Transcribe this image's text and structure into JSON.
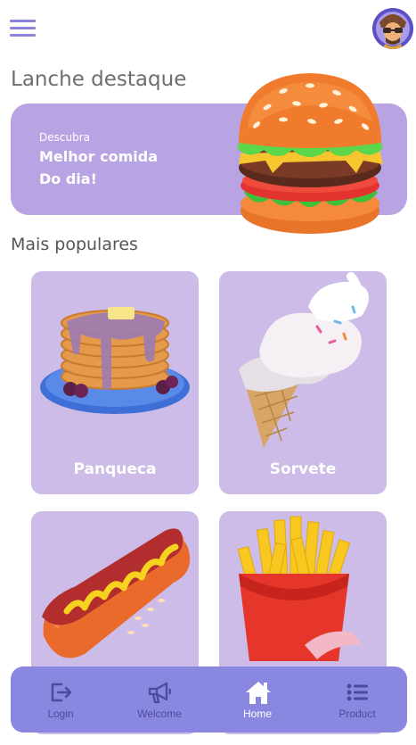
{
  "header": {
    "menu_icon": "hamburger-menu-icon",
    "avatar_icon": "user-avatar"
  },
  "featured": {
    "title": "Lanche destaque",
    "subtitle": "Descubra",
    "headline_line1": "Melhor comida",
    "headline_line2": "Do dia!",
    "image": "burger"
  },
  "popular": {
    "title": "Mais populares",
    "items": [
      {
        "label": "Panqueca",
        "image": "pancakes"
      },
      {
        "label": "Sorvete",
        "image": "ice-cream"
      },
      {
        "label": "",
        "image": "hot-dog"
      },
      {
        "label": "",
        "image": "french-fries"
      }
    ]
  },
  "bottom_nav": {
    "items": [
      {
        "label": "Login",
        "icon": "login-icon"
      },
      {
        "label": "Welcome",
        "icon": "megaphone-icon"
      },
      {
        "label": "Home",
        "icon": "home-icon",
        "active": true
      },
      {
        "label": "Product",
        "icon": "list-icon"
      }
    ]
  },
  "colors": {
    "accent": "#8a87e1",
    "banner": "#b9a4e3",
    "card": "#cdbce8",
    "nav_active": "#ffffff",
    "nav_inactive": "#4c4a9e"
  }
}
